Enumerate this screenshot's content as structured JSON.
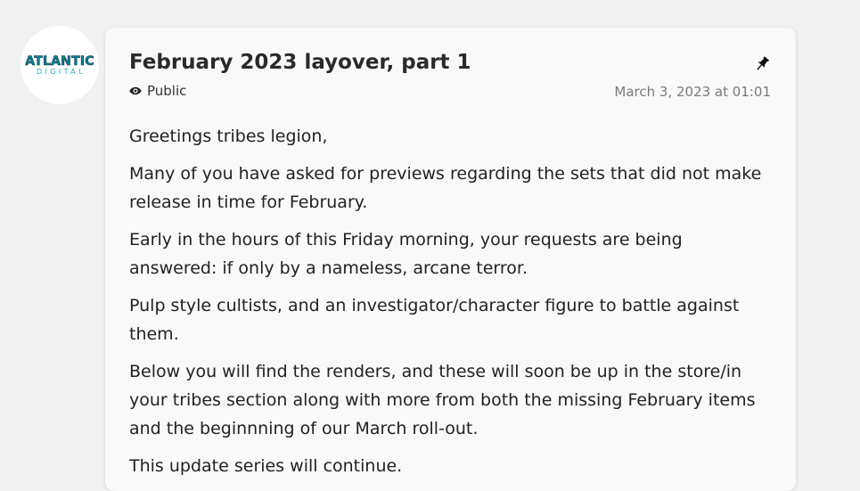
{
  "author": {
    "logo_top": "ATLANTIC",
    "logo_bottom": "DIGITAL"
  },
  "post": {
    "title": "February 2023 layover, part 1",
    "visibility": "Public",
    "date": "March 3, 2023 at 01:01",
    "paragraphs": [
      "Greetings tribes legion,",
      "Many of you have asked for previews regarding the sets that did not make release in time for February.",
      "Early in the hours of this Friday morning, your requests are being answered: if only by a nameless, arcane terror.",
      "Pulp style cultists, and an investigator/character figure to battle against them.",
      "Below you will find the renders, and these will soon be up in the store/in your tribes section along with more from both the missing February items and the beginnning of our March roll-out.",
      "This update series will continue."
    ]
  },
  "icons": {
    "pin": "pin-icon",
    "visibility": "eye-icon"
  }
}
